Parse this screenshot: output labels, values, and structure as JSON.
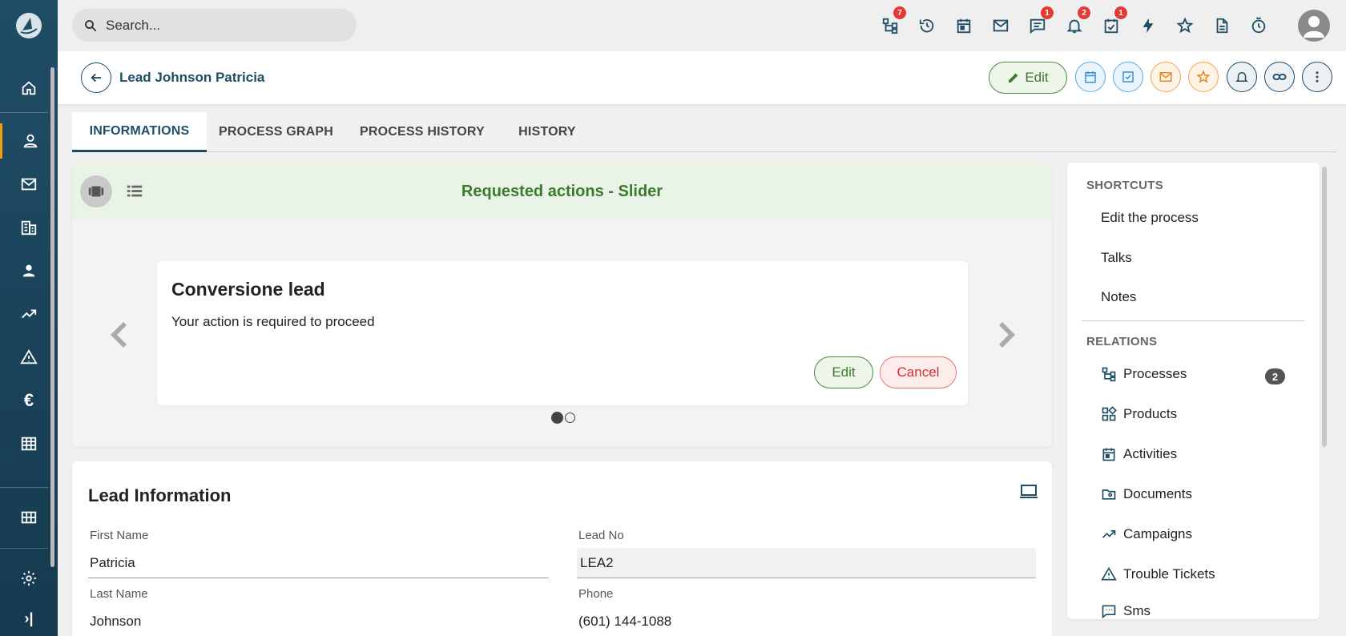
{
  "search": {
    "placeholder": "Search..."
  },
  "topbar": {
    "icons": [
      {
        "name": "processes-icon",
        "badge": "7"
      },
      {
        "name": "history-icon",
        "badge": ""
      },
      {
        "name": "calendar-icon",
        "badge": ""
      },
      {
        "name": "mail-icon",
        "badge": ""
      },
      {
        "name": "chat-icon",
        "badge": "1"
      },
      {
        "name": "bell-icon",
        "badge": "2"
      },
      {
        "name": "task-check-icon",
        "badge": "1"
      },
      {
        "name": "lightning-icon",
        "badge": ""
      },
      {
        "name": "star-icon",
        "badge": ""
      },
      {
        "name": "document-icon",
        "badge": ""
      },
      {
        "name": "timer-icon",
        "badge": ""
      }
    ]
  },
  "sidebar": {
    "items": [
      {
        "name": "home-icon"
      },
      {
        "name": "lead-person-icon",
        "active": true
      },
      {
        "name": "mail-icon"
      },
      {
        "name": "building-icon"
      },
      {
        "name": "contact-person-icon"
      },
      {
        "name": "trending-icon"
      },
      {
        "name": "warning-icon"
      },
      {
        "name": "euro-icon"
      },
      {
        "name": "table-icon"
      },
      {
        "name": "grid-icon"
      },
      {
        "name": "settings-icon"
      },
      {
        "name": "expand-icon"
      }
    ]
  },
  "header": {
    "title": "Lead Johnson Patricia",
    "edit_label": "Edit"
  },
  "tabs": [
    {
      "label": "INFORMATIONS",
      "active": true
    },
    {
      "label": "PROCESS GRAPH"
    },
    {
      "label": "PROCESS HISTORY"
    },
    {
      "label": "HISTORY"
    }
  ],
  "slider": {
    "title": "Requested actions - Slider",
    "card": {
      "title": "Conversione lead",
      "message": "Your action is required to proceed",
      "edit_label": "Edit",
      "cancel_label": "Cancel"
    },
    "pages": 2,
    "current_page": 1
  },
  "lead": {
    "section_title": "Lead Information",
    "fields": {
      "first_name": {
        "label": "First Name",
        "value": "Patricia"
      },
      "lead_no": {
        "label": "Lead No",
        "value": "LEA2"
      },
      "last_name": {
        "label": "Last Name",
        "value": "Johnson"
      },
      "phone": {
        "label": "Phone",
        "value": "(601) 144-1088"
      }
    }
  },
  "shortcuts": {
    "title": "SHORTCUTS",
    "items": [
      "Edit the process",
      "Talks",
      "Notes"
    ]
  },
  "relations": {
    "title": "RELATIONS",
    "items": [
      {
        "label": "Processes",
        "icon": "processes-icon",
        "count": "2"
      },
      {
        "label": "Products",
        "icon": "products-icon"
      },
      {
        "label": "Activities",
        "icon": "calendar-icon"
      },
      {
        "label": "Documents",
        "icon": "folder-icon"
      },
      {
        "label": "Campaigns",
        "icon": "trending-icon"
      },
      {
        "label": "Trouble Tickets",
        "icon": "warning-icon"
      },
      {
        "label": "Sms",
        "icon": "sms-icon"
      }
    ]
  },
  "colors": {
    "brand": "#1f4d66",
    "accent_green": "#3b7a2e",
    "danger": "#d32f2f",
    "badge_red": "#e53935",
    "active_orange": "#f39c12"
  }
}
